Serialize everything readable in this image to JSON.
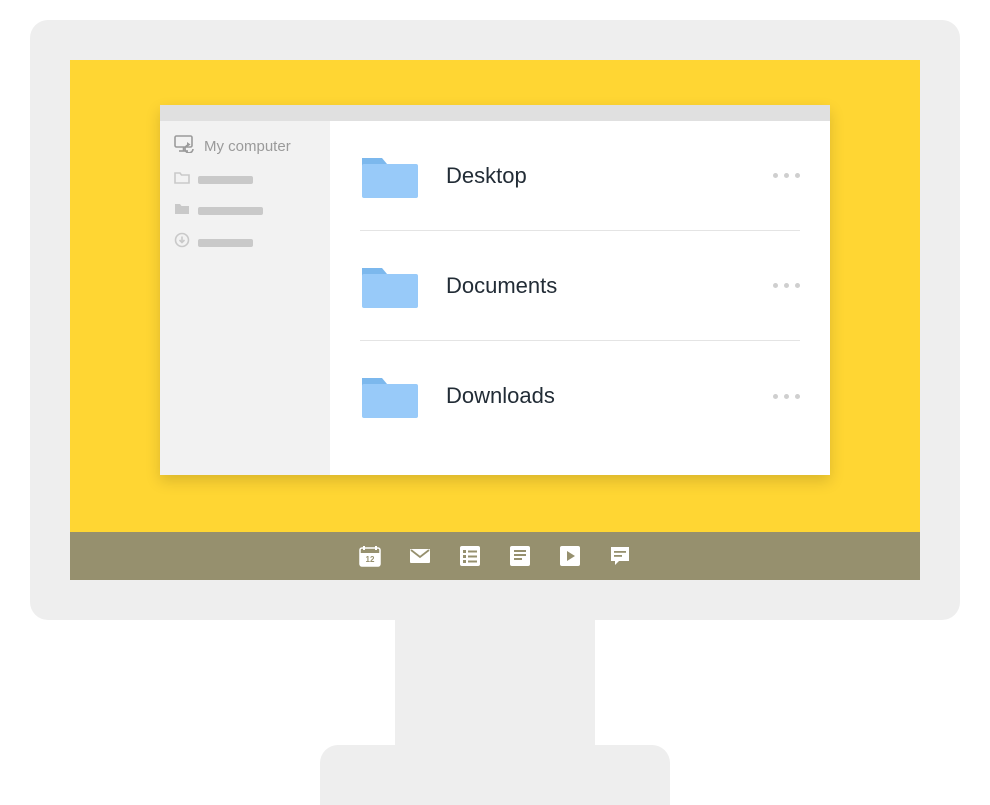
{
  "sidebar": {
    "root_label": "My computer"
  },
  "folders": [
    {
      "name": "Desktop"
    },
    {
      "name": "Documents"
    },
    {
      "name": "Downloads"
    }
  ],
  "taskbar": {
    "calendar_day": "12"
  },
  "colors": {
    "desktop": "#ffd633",
    "folder": "#98caf9",
    "folder_tab": "#7cb8ed"
  }
}
